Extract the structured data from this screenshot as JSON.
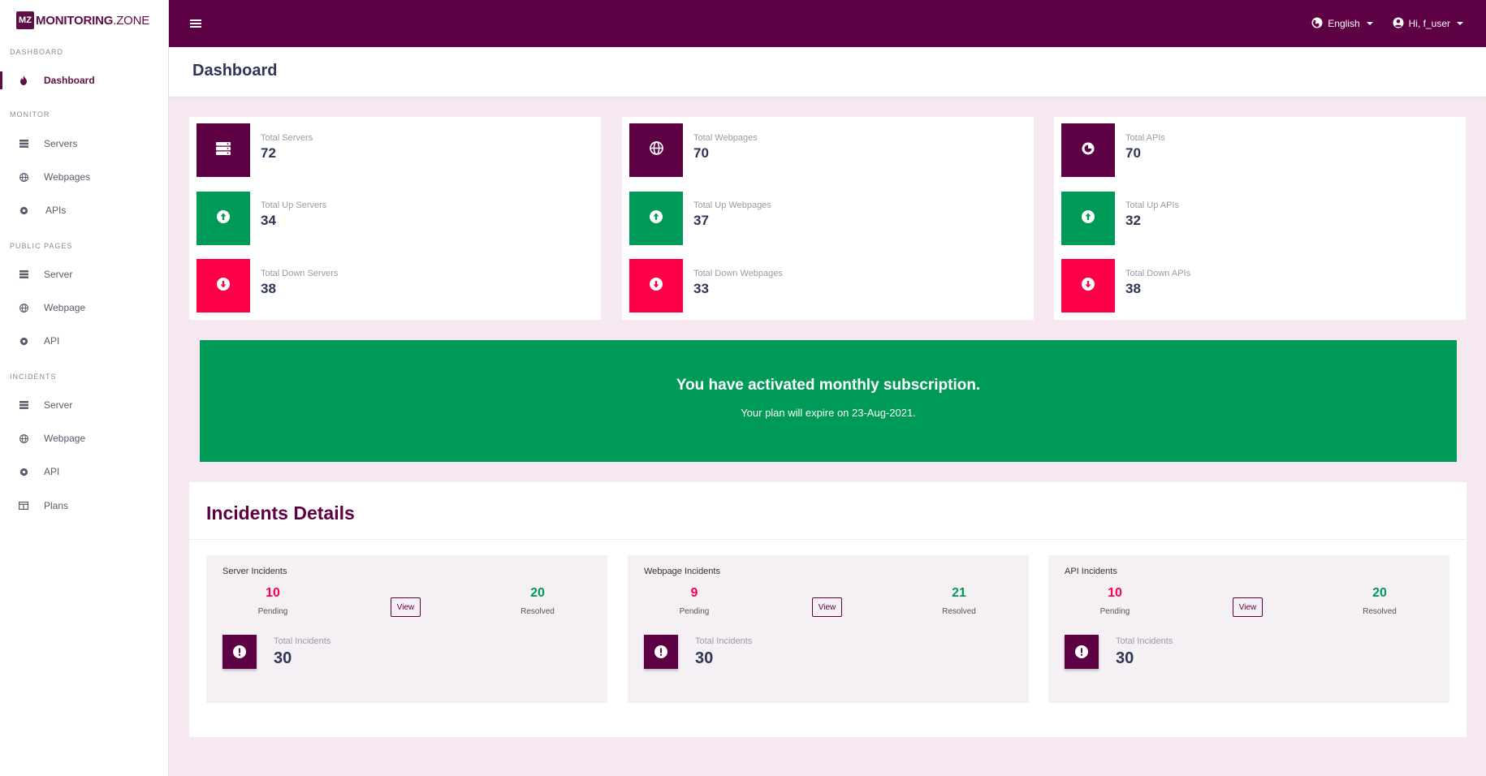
{
  "brand": {
    "mark": "MZ",
    "name_bold": "MONITORING",
    "name_rest": ".ZONE"
  },
  "sidebar": {
    "sections": [
      {
        "title": "DASHBOARD",
        "items": [
          {
            "label": "Dashboard",
            "icon": "fire-icon",
            "active": true
          }
        ]
      },
      {
        "title": "MONITOR",
        "items": [
          {
            "label": "Servers",
            "icon": "server-icon"
          },
          {
            "label": "Webpages",
            "icon": "globe-icon"
          },
          {
            "label": "APIs",
            "icon": "api-icon"
          }
        ]
      },
      {
        "title": "PUBLIC PAGES",
        "items": [
          {
            "label": "Server",
            "icon": "server-icon"
          },
          {
            "label": "Webpage",
            "icon": "globe-icon"
          },
          {
            "label": "API",
            "icon": "api-icon"
          }
        ]
      },
      {
        "title": "INCIDENTS",
        "items": [
          {
            "label": "Server",
            "icon": "server-icon"
          },
          {
            "label": "Webpage",
            "icon": "globe-icon"
          },
          {
            "label": "API",
            "icon": "api-icon"
          },
          {
            "label": "Plans",
            "icon": "table-icon"
          }
        ]
      }
    ]
  },
  "topbar": {
    "language": "English",
    "user_greeting": "Hi, f_user"
  },
  "page": {
    "title": "Dashboard"
  },
  "stats": {
    "servers": {
      "total_label": "Total Servers",
      "total": "72",
      "up_label": "Total Up Servers",
      "up": "34",
      "down_label": "Total Down Servers",
      "down": "38"
    },
    "webpages": {
      "total_label": "Total Webpages",
      "total": "70",
      "up_label": "Total Up Webpages",
      "up": "37",
      "down_label": "Total Down Webpages",
      "down": "33"
    },
    "apis": {
      "total_label": "Total APIs",
      "total": "70",
      "up_label": "Total Up APIs",
      "up": "32",
      "down_label": "Total Down APIs",
      "down": "38"
    }
  },
  "subscription": {
    "headline": "You have activated monthly subscription.",
    "expiry": "Your plan will expire on 23-Aug-2021."
  },
  "incidents": {
    "title": "Incidents Details",
    "view_label": "View",
    "pending_label": "Pending",
    "resolved_label": "Resolved",
    "total_label": "Total Incidents",
    "cards": [
      {
        "title": "Server Incidents",
        "pending": "10",
        "resolved": "20",
        "total": "30"
      },
      {
        "title": "Webpage Incidents",
        "pending": "9",
        "resolved": "21",
        "total": "30"
      },
      {
        "title": "API Incidents",
        "pending": "10",
        "resolved": "20",
        "total": "30"
      }
    ]
  },
  "colors": {
    "brand": "#5e0044",
    "success": "#009a58",
    "danger": "#ff0048",
    "page_bg": "#f5e8f1"
  }
}
